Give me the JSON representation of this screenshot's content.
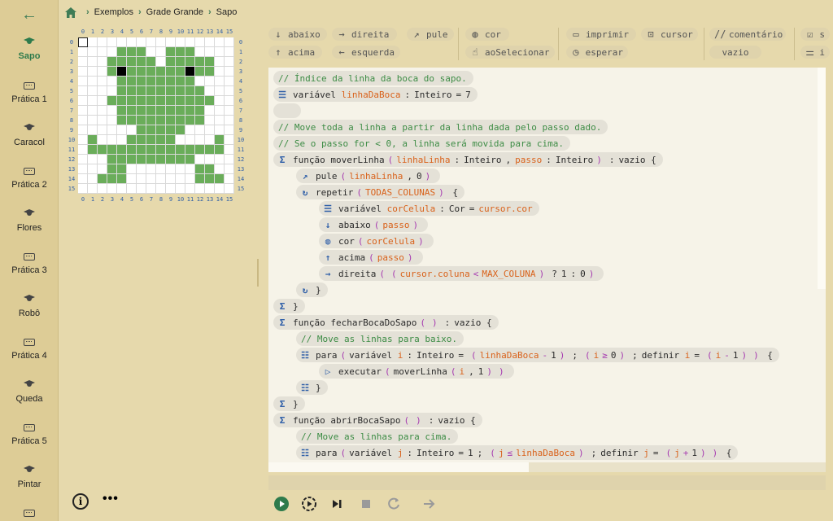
{
  "sidebar": {
    "items": [
      {
        "label": "Sapo",
        "icon": "graduation-cap-icon",
        "active": true
      },
      {
        "label": "Prática 1",
        "icon": "keyboard-icon"
      },
      {
        "label": "Caracol",
        "icon": "graduation-cap-icon"
      },
      {
        "label": "Prática 2",
        "icon": "keyboard-icon"
      },
      {
        "label": "Flores",
        "icon": "graduation-cap-icon"
      },
      {
        "label": "Prática 3",
        "icon": "keyboard-icon"
      },
      {
        "label": "Robô",
        "icon": "graduation-cap-icon"
      },
      {
        "label": "Prática 4",
        "icon": "keyboard-icon"
      },
      {
        "label": "Queda",
        "icon": "graduation-cap-icon"
      },
      {
        "label": "Prática 5",
        "icon": "keyboard-icon"
      },
      {
        "label": "Pintar",
        "icon": "graduation-cap-icon"
      },
      {
        "label": "",
        "icon": "keyboard-icon"
      }
    ]
  },
  "breadcrumb": [
    "Exemplos",
    "Grade Grande",
    "Sapo"
  ],
  "grid": {
    "size": 16,
    "labels": [
      "0",
      "1",
      "2",
      "3",
      "4",
      "5",
      "6",
      "7",
      "8",
      "9",
      "10",
      "11",
      "12",
      "13",
      "14",
      "15"
    ],
    "green": "#6aad5a",
    "black": "#000000",
    "rows": [
      "................",
      "....GGG..GGG....",
      "...GGGGG.GGGGG..",
      "...GBGGGGGGBGG..",
      "....GGGGGGGG....",
      "....GGGGGGGGG...",
      "...GGGGGGGGGGG..",
      "....GGGGGGGGG...",
      "....GGGGGGGGG...",
      "......GGGGG.....",
      ".G...GGGGG....G.",
      ".GGGGGGGGGGGGGG.",
      "...GGGGGGGGG....",
      "...GG.......GG..",
      "..GGG.......GGG.",
      "................"
    ]
  },
  "palette": [
    {
      "label": "abaixo",
      "icon": "arrow-down-icon"
    },
    {
      "label": "acima",
      "icon": "arrow-up-icon"
    },
    {
      "label": "direita",
      "icon": "arrow-right-icon"
    },
    {
      "label": "esquerda",
      "icon": "arrow-left-icon"
    },
    {
      "label": "pule",
      "icon": "trend-icon"
    },
    {
      "label": "cor",
      "icon": "palette-icon"
    },
    {
      "label": "aoSelecionar",
      "icon": "hand-pointer-icon"
    },
    {
      "label": "imprimir",
      "icon": "monitor-icon"
    },
    {
      "label": "cursor",
      "icon": "cursor-target-icon"
    },
    {
      "label": "esperar",
      "icon": "clock-icon"
    },
    {
      "label": "comentário",
      "icon": "comment-slash-icon"
    },
    {
      "label": "vazio",
      "icon": ""
    },
    {
      "label": "s",
      "icon": "checklist-icon"
    },
    {
      "label": "i",
      "icon": "sliders-icon"
    }
  ],
  "code": {
    "l1": "// Índice da linha da boca do sapo.",
    "l2_kw": "variável",
    "l2_id": "linhaDaBoca",
    "l2_type": "Inteiro",
    "l2_val": "7",
    "l4": "// Move toda a linha a partir da linha dada pelo passo dado.",
    "l5": "// Se o passo for < 0, a linha será movida para cima.",
    "fn1_kw": "função",
    "fn1_name": "moverLinha",
    "fn1_p1": "linhaLinha",
    "fn1_p2": "passo",
    "int": "Inteiro",
    "void": "vazio",
    "pule": "pule",
    "zero": "0",
    "repetir": "repetir",
    "todas": "TODAS_COLUNAS",
    "corCelula": "corCelula",
    "Cor": "Cor",
    "cursorCor": "cursor.cor",
    "abaixo": "abaixo",
    "cor": "cor",
    "acima": "acima",
    "direita": "direita",
    "cursorColuna": "cursor.coluna",
    "maxColuna": "MAX_COLUNA",
    "one": "1",
    "fn2_name": "fecharBocaDoSapo",
    "c2": "// Move as linhas para baixo.",
    "para": "para",
    "i": "i",
    "definir": "definir",
    "executar": "executar",
    "fn3_name": "abrirBocaSapo",
    "c3": "// Move as linhas para cima.",
    "j": "j"
  }
}
